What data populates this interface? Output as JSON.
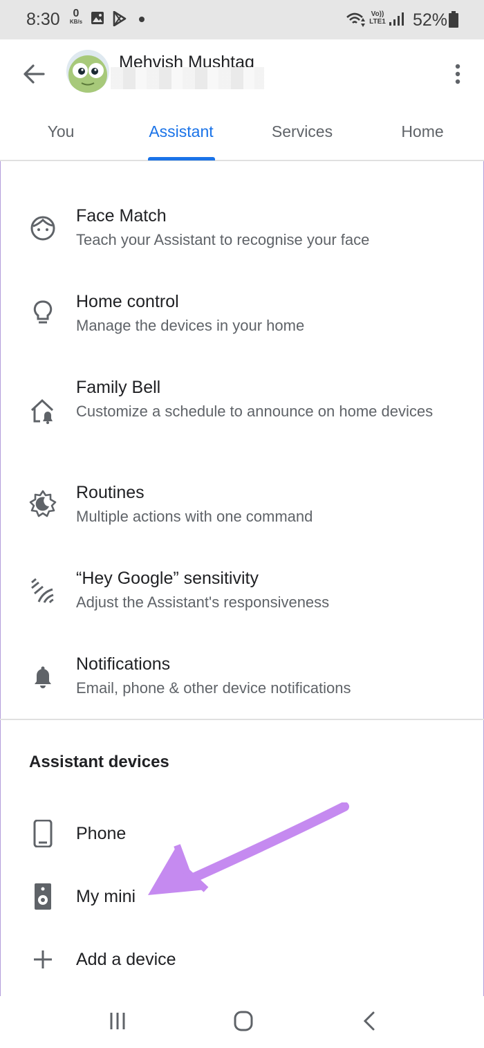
{
  "status_bar": {
    "time": "8:30",
    "net_speed_value": "0",
    "net_speed_unit": "KB/s",
    "volte_label": "Vo)) LTE1",
    "battery": "52%"
  },
  "header": {
    "user_name": "Mehvish Mushtaq",
    "tabs": [
      {
        "label": "You"
      },
      {
        "label": "Assistant"
      },
      {
        "label": "Services"
      },
      {
        "label": "Home"
      }
    ],
    "active_tab": "Assistant"
  },
  "settings": [
    {
      "title": "Face Match",
      "subtitle": "Teach your Assistant to recognise your face",
      "icon": "face-icon"
    },
    {
      "title": "Home control",
      "subtitle": "Manage the devices in your home",
      "icon": "lightbulb-icon"
    },
    {
      "title": "Family Bell",
      "subtitle": "Customize a schedule to announce on home devices",
      "icon": "home-bell-icon"
    },
    {
      "title": "Routines",
      "subtitle": "Multiple actions with one command",
      "icon": "routines-icon"
    },
    {
      "title": "“Hey Google” sensitivity",
      "subtitle": "Adjust the Assistant's responsiveness",
      "icon": "sensitivity-icon"
    },
    {
      "title": "Notifications",
      "subtitle": "Email, phone & other device notifications",
      "icon": "bell-icon"
    }
  ],
  "assistant_devices": {
    "title": "Assistant devices",
    "items": [
      {
        "label": "Phone",
        "icon": "phone-icon"
      },
      {
        "label": "My mini",
        "icon": "speaker-icon"
      },
      {
        "label": "Add a device",
        "icon": "plus-icon"
      }
    ]
  },
  "colors": {
    "accent": "#1a73e8",
    "annotation_arrow": "#c58af0",
    "status_bar_bg": "#e6e6e6"
  }
}
